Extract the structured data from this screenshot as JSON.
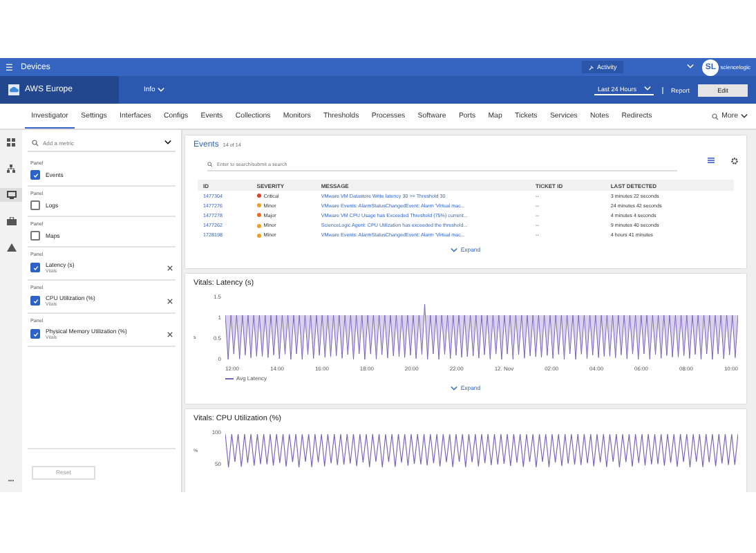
{
  "topbar": {
    "menu_icon": "☰",
    "title": "Devices",
    "activity": "Activity",
    "logo_mark": "SL",
    "logo_text": "sciencelogic"
  },
  "devicebar": {
    "device": "AWS Europe",
    "info": "Info",
    "range": "Last 24 Hours",
    "report": "Report",
    "edit": "Edit"
  },
  "tabs": [
    {
      "label": "Investigator",
      "selected": true
    },
    {
      "label": "Settings",
      "selected": false
    },
    {
      "label": "Interfaces",
      "selected": false
    },
    {
      "label": "Configs",
      "selected": false
    },
    {
      "label": "Events",
      "selected": false
    },
    {
      "label": "Collections",
      "selected": false
    },
    {
      "label": "Monitors",
      "selected": false
    },
    {
      "label": "Thresholds",
      "selected": false
    },
    {
      "label": "Processes",
      "selected": false
    },
    {
      "label": "Software",
      "selected": false
    },
    {
      "label": "Ports",
      "selected": false
    },
    {
      "label": "Map",
      "selected": false
    },
    {
      "label": "Tickets",
      "selected": false
    },
    {
      "label": "Services",
      "selected": false
    },
    {
      "label": "Notes",
      "selected": false
    },
    {
      "label": "Redirects",
      "selected": false
    }
  ],
  "more": "More",
  "sidebar": {
    "search": {
      "placeholder": "Add a metric"
    },
    "panels": [
      {
        "caption": "Panel",
        "label": "Events",
        "checked": true,
        "removable": false
      },
      {
        "caption": "Panel",
        "label": "Logs",
        "checked": false,
        "removable": false
      },
      {
        "caption": "Panel",
        "label": "Maps",
        "checked": false,
        "removable": false
      },
      {
        "caption": "Panel",
        "label": "Latency (s)",
        "sub": "Vitals",
        "checked": true,
        "removable": true
      },
      {
        "caption": "Panel",
        "label": "CPU Utilization (%)",
        "sub": "Vitals",
        "checked": true,
        "removable": true
      },
      {
        "caption": "Panel",
        "label": "Physical Memory Utilization (%)",
        "sub": "Vitals",
        "checked": true,
        "removable": true
      }
    ],
    "reset": "Reset",
    "rail_more": "•••"
  },
  "events": {
    "title": "Events",
    "count": "14 of 14",
    "search": {
      "placeholder": "Enter to search/submit a search"
    },
    "columns": [
      "ID",
      "SEVERITY",
      "MESSAGE",
      "TICKET ID",
      "LAST DETECTED"
    ],
    "rows": [
      {
        "id": "1477304",
        "severity": "Critical",
        "color": "#e0402a",
        "message": "VMware VM Datastore Write latency 30 >= Threshold 30",
        "ticket": "--",
        "last": "3 minutes 22 seconds"
      },
      {
        "id": "1477276",
        "severity": "Minor",
        "color": "#f0a020",
        "message": "VMware Events: AlarmStatusChangedEvent: Alarm 'Virtual mac...",
        "ticket": "--",
        "last": "24 minutes 42 seconds"
      },
      {
        "id": "1477278",
        "severity": "Major",
        "color": "#f06a20",
        "message": "VMware VM CPU Usage has Exceeded Threshold (75%) current...",
        "ticket": "--",
        "last": "4 minutes 4 seconds"
      },
      {
        "id": "1477262",
        "severity": "Minor",
        "color": "#f0a020",
        "message": "ScienceLogic Agent: CPU Utilization has exceeded the threshold...",
        "ticket": "--",
        "last": "9 minutes 40 seconds"
      },
      {
        "id": "1728198",
        "severity": "Minor",
        "color": "#f0a020",
        "message": "VMware Events: AlarmStatusChangedEvent: Alarm 'Virtual mac...",
        "ticket": "--",
        "last": "4 hours 41 minutes"
      }
    ],
    "expand": "Expand"
  },
  "latency": {
    "title": "Vitals: Latency (s)",
    "y_label": "s",
    "y_ticks": [
      "1.5",
      "1",
      "0.5",
      "0"
    ],
    "x_ticks": [
      "12:00",
      "14:00",
      "16:00",
      "18:00",
      "20:00",
      "22:00",
      "12. Nov",
      "02:00",
      "04:00",
      "06:00",
      "08:00",
      "10:00"
    ],
    "legend": "Avg Latency",
    "expand": "Expand"
  },
  "cpu": {
    "title": "Vitals: CPU Utilization (%)",
    "y_label": "%",
    "y_ticks": [
      "100",
      "50"
    ]
  }
}
